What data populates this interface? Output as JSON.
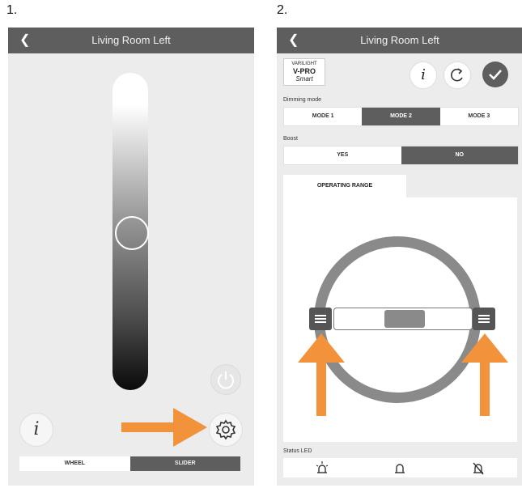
{
  "steps": [
    "1.",
    "2."
  ],
  "screen1": {
    "title": "Living Room Left",
    "info_label": "i",
    "modes": [
      "WHEEL",
      "SLIDER"
    ],
    "slider_level_percent": 50
  },
  "screen2": {
    "title": "Living Room Left",
    "logo": {
      "line1": "VARILIGHT",
      "line2": "V-PRO",
      "line3": "Smart"
    },
    "info_label": "i",
    "dimming_label": "Dimming mode",
    "dimming_modes": [
      "MODE 1",
      "MODE 2",
      "MODE 3"
    ],
    "dimming_selected": "MODE 2",
    "boost_label": "Boost",
    "boost_options": [
      "YES",
      "NO"
    ],
    "boost_selected": "NO",
    "tab_label": "OPERATING RANGE",
    "status_led_label": "Status LED"
  },
  "colors": {
    "accent_arrow": "#F2933B",
    "dark": "#5E5E5E"
  }
}
